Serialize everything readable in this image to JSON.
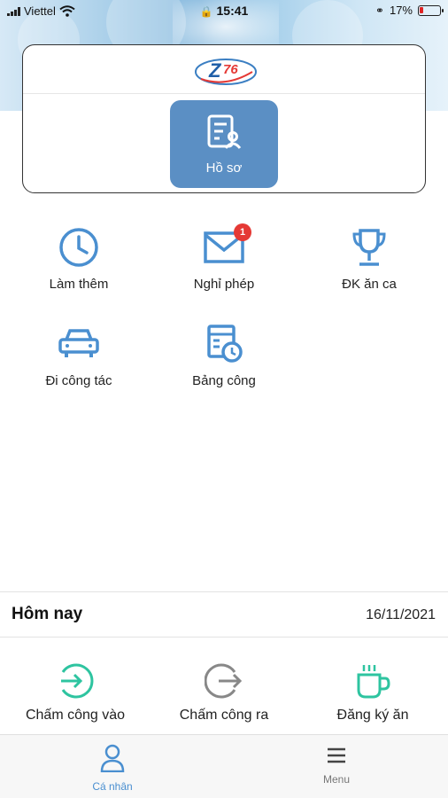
{
  "status_bar": {
    "carrier": "Viettel",
    "time": "15:41",
    "battery_percent": "17%",
    "battery_color": "#e02424"
  },
  "card": {
    "logo_text": "Z76",
    "profile_button": {
      "label": "Hồ sơ",
      "icon": "document-user-icon"
    }
  },
  "grid": [
    {
      "label": "Làm thêm",
      "icon": "clock-icon"
    },
    {
      "label": "Nghỉ phép",
      "icon": "envelope-icon",
      "badge": "1"
    },
    {
      "label": "ĐK ăn ca",
      "icon": "trophy-icon"
    },
    {
      "label": "Đi công tác",
      "icon": "car-icon"
    },
    {
      "label": "Bảng công",
      "icon": "timesheet-icon"
    }
  ],
  "today": {
    "title": "Hôm nay",
    "date": "16/11/2021"
  },
  "actions": [
    {
      "label": "Chấm công vào",
      "icon": "check-in-icon",
      "color": "#2ec4a0"
    },
    {
      "label": "Chấm công ra",
      "icon": "check-out-icon",
      "color": "#888888"
    },
    {
      "label": "Đăng ký ăn",
      "icon": "coffee-cup-icon",
      "color": "#2ec4a0"
    }
  ],
  "tabbar": [
    {
      "label": "Cá nhân",
      "icon": "person-icon",
      "active": true,
      "color": "#4a8fd0"
    },
    {
      "label": "Menu",
      "icon": "hamburger-menu-icon",
      "active": false,
      "color": "#777777"
    }
  ],
  "colors": {
    "primary": "#5b8fc4",
    "icon_blue": "#4a8fd0",
    "badge_red": "#e53935"
  }
}
